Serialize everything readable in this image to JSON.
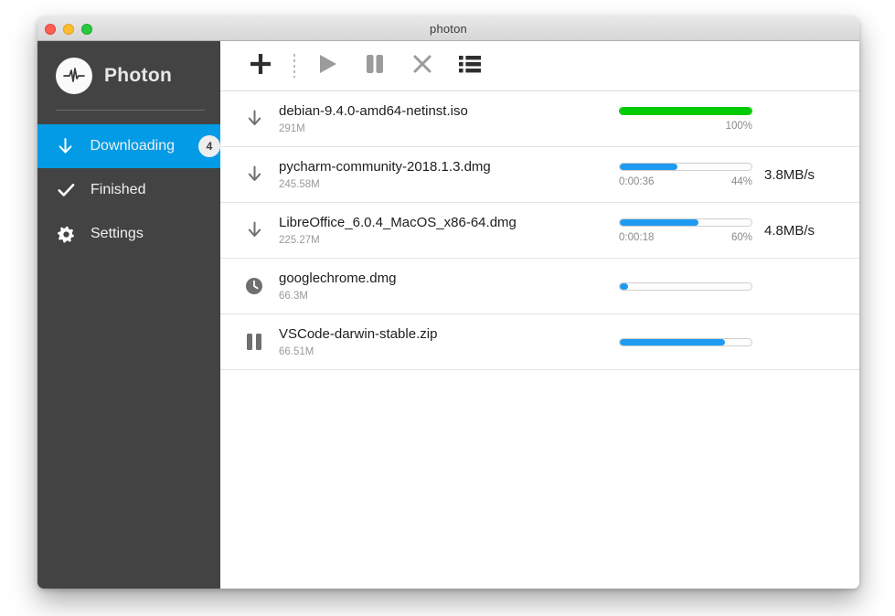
{
  "window": {
    "title": "photon",
    "traffic_lights": [
      "close",
      "minimize",
      "zoom"
    ]
  },
  "sidebar": {
    "brand": {
      "name": "Photon",
      "logo_icon": "waveform-pulse-icon"
    },
    "items": [
      {
        "label": "Downloading",
        "icon": "arrow-down-icon",
        "badge": "4",
        "active": true
      },
      {
        "label": "Finished",
        "icon": "check-icon",
        "badge": "",
        "active": false
      },
      {
        "label": "Settings",
        "icon": "gear-icon",
        "badge": "",
        "active": false
      }
    ]
  },
  "toolbar": {
    "buttons": [
      {
        "name": "add-download-button",
        "icon": "plus-icon"
      },
      {
        "name": "resume-button",
        "icon": "play-icon"
      },
      {
        "name": "pause-button",
        "icon": "pause-icon"
      },
      {
        "name": "remove-button",
        "icon": "close-x-icon"
      },
      {
        "name": "list-view-button",
        "icon": "list-icon"
      }
    ]
  },
  "downloads": [
    {
      "name": "debian-9.4.0-amd64-netinst.iso",
      "size": "291M",
      "status_icon": "arrow-down-icon",
      "percent": 100,
      "percent_label": "100%",
      "eta": "",
      "speed": "",
      "complete": true
    },
    {
      "name": "pycharm-community-2018.1.3.dmg",
      "size": "245.58M",
      "status_icon": "arrow-down-icon",
      "percent": 44,
      "percent_label": "44%",
      "eta": "0:00:36",
      "speed": "3.8MB/s",
      "complete": false
    },
    {
      "name": "LibreOffice_6.0.4_MacOS_x86-64.dmg",
      "size": "225.27M",
      "status_icon": "arrow-down-icon",
      "percent": 60,
      "percent_label": "60%",
      "eta": "0:00:18",
      "speed": "4.8MB/s",
      "complete": false
    },
    {
      "name": "googlechrome.dmg",
      "size": "66.3M",
      "status_icon": "clock-icon",
      "percent": 4,
      "percent_label": "",
      "eta": "",
      "speed": "",
      "complete": false
    },
    {
      "name": "VSCode-darwin-stable.zip",
      "size": "66.51M",
      "status_icon": "pause-icon",
      "percent": 80,
      "percent_label": "",
      "eta": "",
      "speed": "",
      "complete": false
    }
  ],
  "colors": {
    "accent_blue": "#039be5",
    "progress_blue": "#1e9bf0",
    "progress_green": "#00cc00",
    "sidebar_dark": "#434343"
  }
}
